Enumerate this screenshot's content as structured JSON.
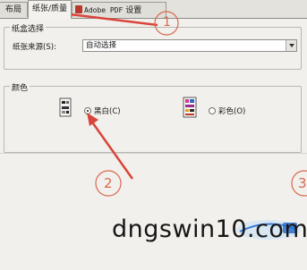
{
  "tabs": [
    {
      "label": "布局"
    },
    {
      "label": "纸张/质量"
    },
    {
      "label_main": "Adobe PDF",
      "label_suffix": " 设置"
    }
  ],
  "paper_source_group": {
    "title": "纸盒选择",
    "source_label": "纸张来源(S):",
    "source_value": "自动选择"
  },
  "color_group": {
    "title": "颜色",
    "options": [
      {
        "label": "黑白(C)",
        "checked": true
      },
      {
        "label": "彩色(O)",
        "checked": false
      }
    ]
  },
  "annotations": {
    "markers": [
      "1",
      "2",
      "3"
    ],
    "arrow_color": "#d9453b",
    "marker_color": "#d9694f"
  },
  "watermark": {
    "text": "dngswin10.com"
  }
}
